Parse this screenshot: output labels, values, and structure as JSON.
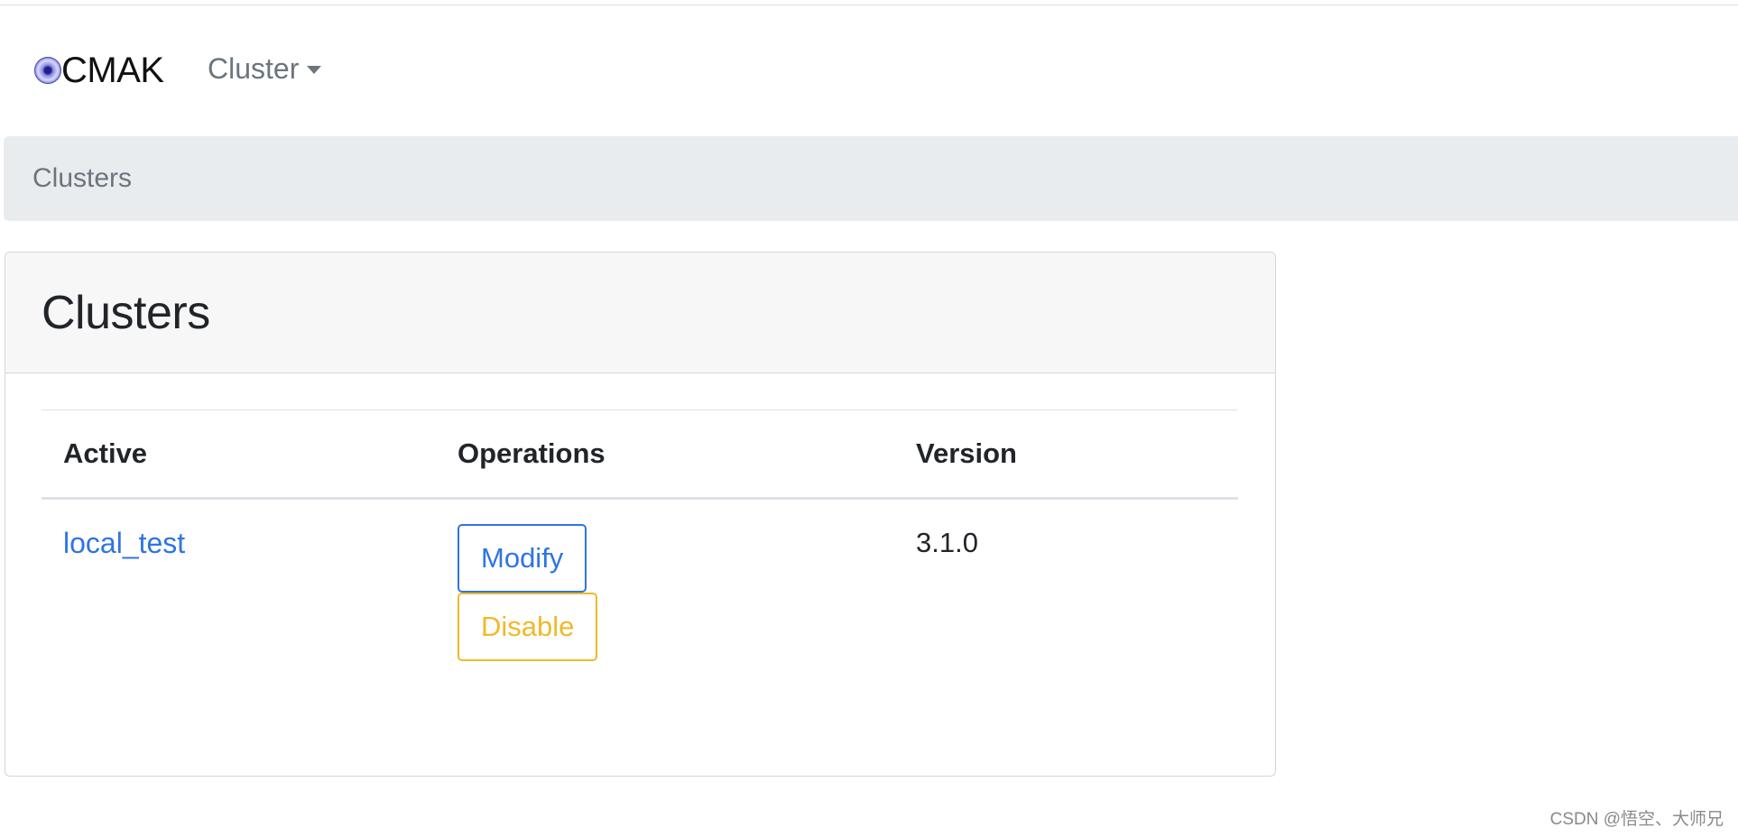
{
  "navbar": {
    "brand": "CMAK",
    "cluster_menu_label": "Cluster"
  },
  "breadcrumb": {
    "current": "Clusters"
  },
  "card": {
    "title": "Clusters",
    "table": {
      "headers": [
        "Active",
        "Operations",
        "Version"
      ],
      "rows": [
        {
          "active": "local_test",
          "operations": {
            "modify_label": "Modify",
            "disable_label": "Disable"
          },
          "version": "3.1.0"
        }
      ]
    }
  },
  "watermark": "CSDN @悟空、大师兄",
  "colors": {
    "link": "#2f74e3",
    "warning": "#f0b929",
    "breadcrumb_bg": "#e9ecef",
    "muted_text": "#6c757d"
  },
  "icons": {
    "brand_logo": "cmak-logo-icon",
    "dropdown": "caret-down-icon"
  }
}
